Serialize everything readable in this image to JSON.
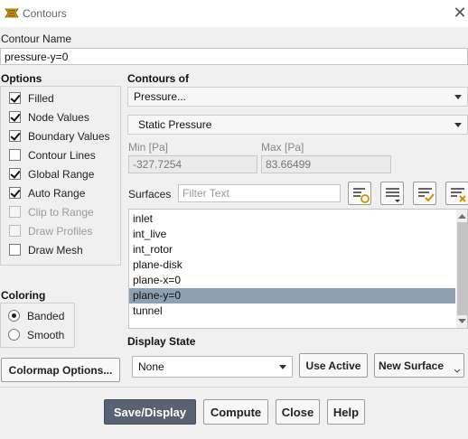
{
  "window": {
    "title": "Contours"
  },
  "contour_name": {
    "label": "Contour Name",
    "value": "pressure-y=0"
  },
  "options": {
    "header": "Options",
    "items": [
      {
        "label": "Filled",
        "checked": true,
        "enabled": true
      },
      {
        "label": "Node Values",
        "checked": true,
        "enabled": true
      },
      {
        "label": "Boundary Values",
        "checked": true,
        "enabled": true
      },
      {
        "label": "Contour Lines",
        "checked": false,
        "enabled": true
      },
      {
        "label": "Global Range",
        "checked": true,
        "enabled": true
      },
      {
        "label": "Auto Range",
        "checked": true,
        "enabled": true
      },
      {
        "label": "Clip to Range",
        "checked": false,
        "enabled": false
      },
      {
        "label": "Draw Profiles",
        "checked": false,
        "enabled": false
      },
      {
        "label": "Draw Mesh",
        "checked": false,
        "enabled": true
      }
    ]
  },
  "coloring": {
    "header": "Coloring",
    "options": [
      {
        "label": "Banded",
        "selected": true
      },
      {
        "label": "Smooth",
        "selected": false
      }
    ],
    "colormap_button": "Colormap Options..."
  },
  "contours_of": {
    "header": "Contours of",
    "category": "Pressure...",
    "variable": "Static Pressure",
    "min_label": "Min [Pa]",
    "min_value": "-327.7254",
    "max_label": "Max [Pa]",
    "max_value": "83.66499"
  },
  "surfaces": {
    "label": "Surfaces",
    "filter_placeholder": "Filter Text",
    "items": [
      "inlet",
      "int_live",
      "int_rotor",
      "plane-disk",
      "plane-x=0",
      "plane-y=0",
      "tunnel"
    ],
    "selected": "plane-y=0"
  },
  "display_state": {
    "header": "Display State",
    "value": "None",
    "use_active": "Use Active",
    "new_surface": "New Surface"
  },
  "footer": {
    "save_display": "Save/Display",
    "compute": "Compute",
    "close": "Close",
    "help": "Help"
  },
  "colors": {
    "selection": "#8ea0b3",
    "primary_button": "#596273"
  }
}
